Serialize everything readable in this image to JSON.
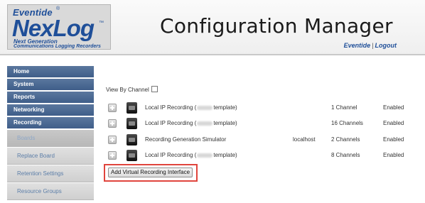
{
  "header": {
    "logo_brand": "Eventide",
    "logo_product": "NexLog",
    "logo_subtitle_1": "Next Generation",
    "logo_subtitle_2": "Communications Logging Recorders",
    "title": "Configuration Manager",
    "link_user": "Eventide",
    "link_separator": "|",
    "link_logout": "Logout"
  },
  "sidebar": {
    "main_items": [
      {
        "label": "Home"
      },
      {
        "label": "System"
      },
      {
        "label": "Reports"
      },
      {
        "label": "Networking"
      },
      {
        "label": "Recording"
      }
    ],
    "sub_items": [
      {
        "label": "Boards",
        "active": true
      },
      {
        "label": "Replace Board"
      },
      {
        "label": "Retention Settings"
      },
      {
        "label": "Resource Groups"
      }
    ]
  },
  "main": {
    "view_by_channel_label": "View By Channel",
    "view_by_channel_checked": false,
    "rows": [
      {
        "name_prefix": "Local IP Recording (",
        "name_suffix": "template)",
        "host": "",
        "channels": "1 Channel",
        "status": "Enabled"
      },
      {
        "name_prefix": "Local IP Recording (",
        "name_suffix": "template)",
        "host": "",
        "channels": "16 Channels",
        "status": "Enabled"
      },
      {
        "name_prefix": "Recording Generation Simulator",
        "name_suffix": "",
        "host": "localhost",
        "channels": "2 Channels",
        "status": "Enabled"
      },
      {
        "name_prefix": "Local IP Recording (",
        "name_suffix": "template)",
        "host": "",
        "channels": "8 Channels",
        "status": "Enabled"
      }
    ],
    "add_button_label": "Add Virtual Recording Interface"
  },
  "colors": {
    "nav_main": "#4a6a94",
    "nav_sub_text": "#5c7ea8",
    "brand_blue": "#1f4f99",
    "highlight": "#e0453d"
  }
}
